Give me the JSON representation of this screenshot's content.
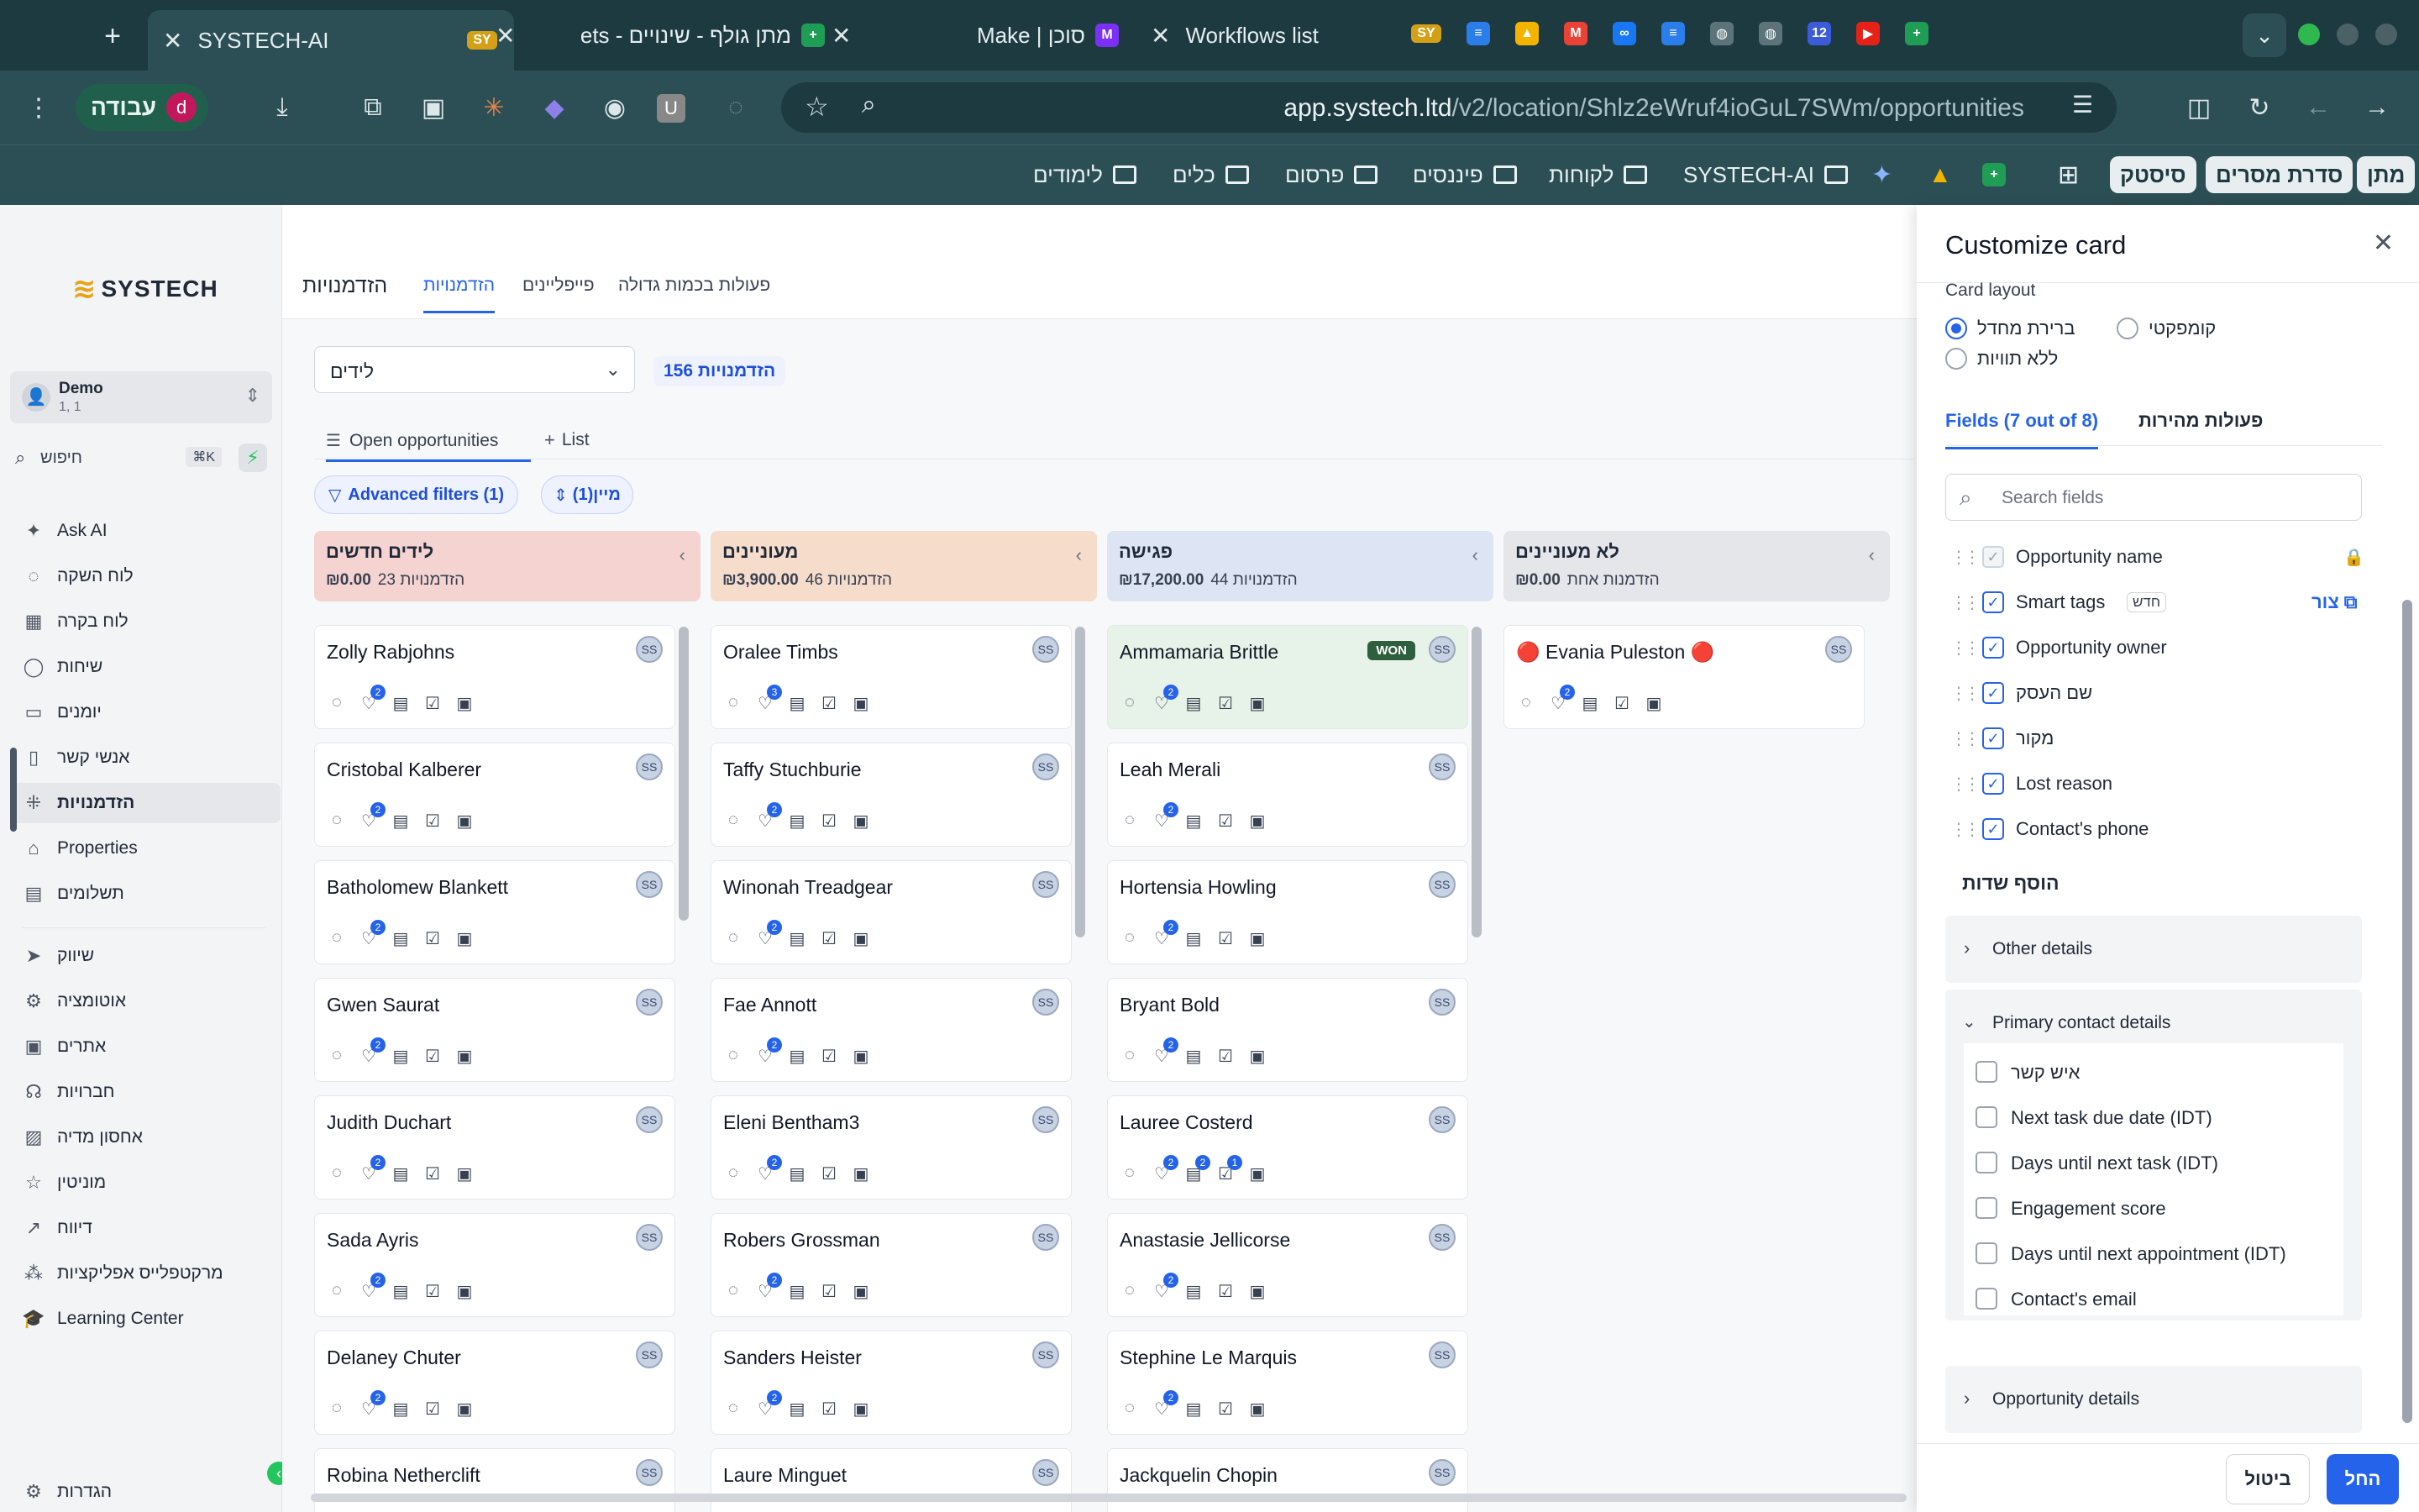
{
  "browser": {
    "tabs": [
      {
        "title": "SYSTECH-AI",
        "active": true
      },
      {
        "title": "מתן גולף - שינויים - ets"
      },
      {
        "title": "Make | סוכן"
      },
      {
        "title": "Workflows list"
      }
    ],
    "profile_label": "עבודה",
    "profile_initial": "d",
    "url_host": "app.systech.ltd",
    "url_path": "/v2/location/Shlz2eWruf4ioGuL7SWm/opportunities",
    "bookmarks": [
      "מתן",
      "סדרת מסרים",
      "סיסטק",
      "SYSTECH-AI",
      "לקוחות",
      "פיננסים",
      "פרסום",
      "כלים",
      "לימודים"
    ]
  },
  "sidebar": {
    "logo": "SYSTECH",
    "account_name": "Demo",
    "account_sub": "1, 1",
    "search_placeholder": "חיפוש",
    "search_shortcut": "⌘K",
    "items": [
      "Ask AI",
      "לוח השקה",
      "לוח בקרה",
      "שיחות",
      "יומנים",
      "אנשי קשר",
      "הזדמנויות",
      "Properties",
      "תשלומים",
      "שיווק",
      "אוטומציה",
      "אתרים",
      "חברויות",
      "אחסון מדיה",
      "מוניטין",
      "דיווח",
      "מרקטפלייס אפליקציות",
      "Learning Center"
    ],
    "settings": "הגדרות"
  },
  "main": {
    "page_title": "הזדמנויות",
    "tabs": [
      "הזדמנויות",
      "פייפליינים",
      "פעולות בכמות גדולה"
    ],
    "pipeline_select": "לידים",
    "count_badge": "156 הזדמנויות",
    "view_tabs": [
      "Open opportunities",
      "List"
    ],
    "advanced_filters": "Advanced filters (1)",
    "sort": "מיין(1)",
    "columns": [
      {
        "title": "לידים חדשים",
        "count": "23 הזדמנויות",
        "amount": "₪0.00",
        "color": "#f4d3d1",
        "cards": [
          "Zolly Rabjohns",
          "Cristobal Kalberer",
          "Batholomew Blankett",
          "Gwen Saurat",
          "Judith Duchart",
          "Sada Ayris",
          "Delaney Chuter",
          "Robina Netherclift"
        ]
      },
      {
        "title": "מעוניינים",
        "count": "46 הזדמנויות",
        "amount": "₪3,900.00",
        "color": "#f6dccb",
        "cards": [
          "Oralee Timbs",
          "Taffy Stuchburie",
          "Winonah Treadgear",
          "Fae Annott",
          "Eleni Bentham3",
          "Robers Grossman",
          "Sanders Heister",
          "Laure Minguet"
        ]
      },
      {
        "title": "פגישה",
        "count": "44 הזדמנויות",
        "amount": "₪17,200.00",
        "color": "#dde5f4",
        "cards": [
          "Ammamaria Brittle",
          "Leah Merali",
          "Hortensia Howling",
          "Bryant Bold",
          "Lauree Costerd",
          "Anastasie Jellicorse",
          "Stephine Le Marquis",
          "Jackquelin Chopin"
        ]
      },
      {
        "title": "לא מעוניינים",
        "count": "הזדמנות אחת",
        "amount": "₪0.00",
        "color": "#e4e6ea",
        "cards": [
          "🔴 Evania Puleston 🔴"
        ]
      }
    ],
    "won_label": "WON",
    "avatar_initials": "SS"
  },
  "panel": {
    "title": "Customize card",
    "card_layout_label": "Card layout",
    "layout_options": [
      "ברירת מחדל",
      "קומפקטי",
      "ללא תוויות"
    ],
    "tab_fields": "Fields (7 out of 8)",
    "tab_quick": "פעולות מהירות",
    "search_placeholder": "Search fields",
    "selected_fields": [
      "Opportunity name",
      "Smart tags",
      "Opportunity owner",
      "שם העסק",
      "מקור",
      "Lost reason",
      "Contact's phone"
    ],
    "new_badge": "חדש",
    "create_link": "צור",
    "add_fields": "הוסף שדות",
    "groups": {
      "other": "Other details",
      "primary": "Primary contact details",
      "opportunity": "Opportunity details"
    },
    "primary_fields": [
      "איש קשר",
      "Next task due date (IDT)",
      "Days until next task (IDT)",
      "Engagement score",
      "Days until next appointment (IDT)",
      "Contact's email"
    ],
    "cancel": "ביטול",
    "apply": "החל"
  }
}
